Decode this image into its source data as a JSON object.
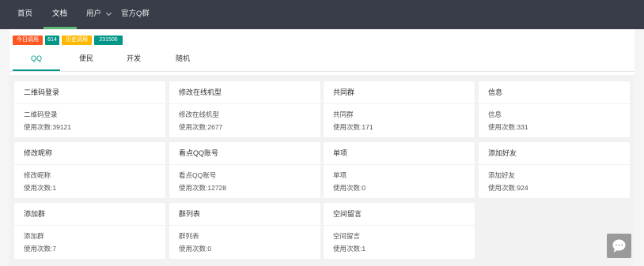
{
  "nav": {
    "home": "首页",
    "docs": "文档",
    "user": "用户",
    "group": "官方Q群"
  },
  "badges": {
    "today_label": "今日调用",
    "today_value": "614",
    "history_label": "历史调用",
    "history_value": "231506"
  },
  "tabs": [
    "QQ",
    "便民",
    "开发",
    "随机"
  ],
  "cards": [
    {
      "title": "二维码登录",
      "desc": "二维码登录",
      "count": "使用次数:39121"
    },
    {
      "title": "修改在线机型",
      "desc": "修改在线机型",
      "count": "使用次数:2677"
    },
    {
      "title": "共同群",
      "desc": "共同群",
      "count": "使用次数:171"
    },
    {
      "title": "信息",
      "desc": "信息",
      "count": "使用次数:331"
    },
    {
      "title": "修改昵称",
      "desc": "修改昵称",
      "count": "使用次数:1"
    },
    {
      "title": "看点QQ账号",
      "desc": "看点QQ账号",
      "count": "使用次数:12728"
    },
    {
      "title": "单项",
      "desc": "单项",
      "count": "使用次数:0"
    },
    {
      "title": "添加好友",
      "desc": "添加好友",
      "count": "使用次数:924"
    },
    {
      "title": "添加群",
      "desc": "添加群",
      "count": "使用次数:7"
    },
    {
      "title": "群列表",
      "desc": "群列表",
      "count": "使用次数:0"
    },
    {
      "title": "空间留言",
      "desc": "空间留言",
      "count": "使用次数:1"
    }
  ],
  "colors": {
    "topbar": "#393d49",
    "accent": "#009688",
    "nav_underline": "#5fb878",
    "badge_today": "#ff5722",
    "badge_count": "#009688",
    "badge_history": "#ffb800"
  },
  "icons": {
    "user_dropdown": "chevron-down-icon",
    "chat": "chat-bubble-icon"
  }
}
